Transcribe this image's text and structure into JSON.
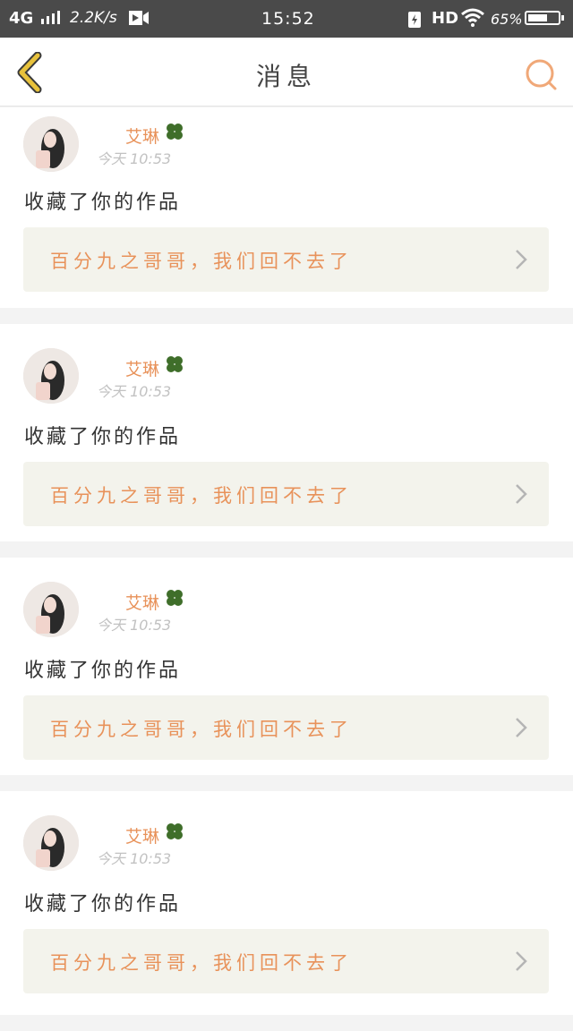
{
  "status_bar": {
    "network": "4G",
    "speed": "2.2K/s",
    "time": "15:52",
    "hd": "HD",
    "battery_percent": "65%",
    "battery_level": 0.65
  },
  "header": {
    "title": "消息",
    "back_icon": "chevron-left-icon",
    "search_icon": "search-icon",
    "accent_color": "#e8c23c",
    "search_color": "#f0a878"
  },
  "messages": [
    {
      "user": "艾琳",
      "time": "今天 10:53",
      "action": "收藏了你的作品",
      "work_title": "百分九之哥哥，我们回不去了"
    },
    {
      "user": "艾琳",
      "time": "今天 10:53",
      "action": "收藏了你的作品",
      "work_title": "百分九之哥哥，我们回不去了"
    },
    {
      "user": "艾琳",
      "time": "今天 10:53",
      "action": "收藏了你的作品",
      "work_title": "百分九之哥哥，我们回不去了"
    },
    {
      "user": "艾琳",
      "time": "今天 10:53",
      "action": "收藏了你的作品",
      "work_title": "百分九之哥哥，我们回不去了"
    }
  ]
}
